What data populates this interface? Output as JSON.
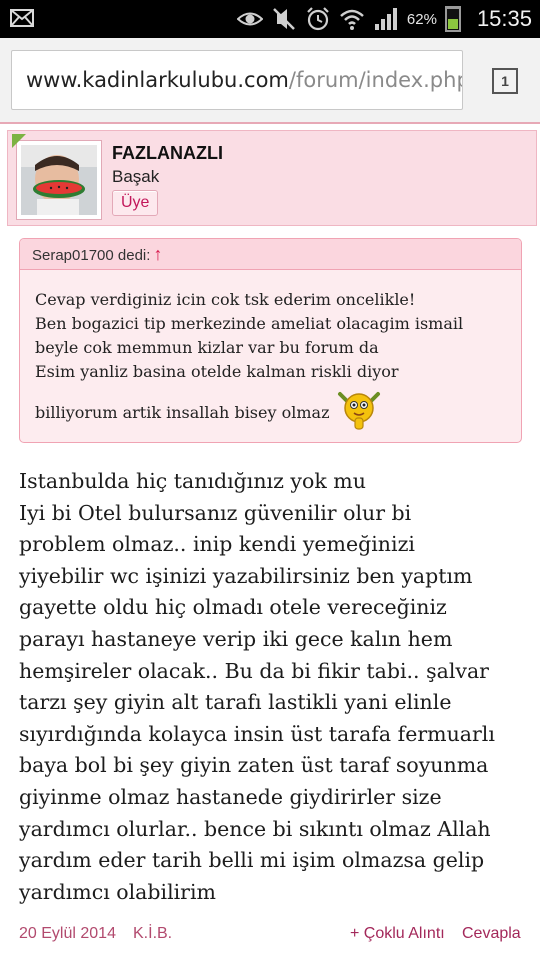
{
  "status_bar": {
    "battery_percent": "62%",
    "time": "15:35",
    "icons": [
      "mail-icon",
      "eye-icon",
      "vibrate-off-icon",
      "alarm-icon",
      "wifi-icon",
      "signal-icon",
      "battery-icon"
    ]
  },
  "browser": {
    "url_host": "www.kadinlarkulubu.com",
    "url_path": "/forum/index.php",
    "tab_count": "1"
  },
  "post": {
    "username": "FAZLANAZLI",
    "real_name": "Başak",
    "role": "Üye",
    "quote": {
      "author_label": "Serap01700 dedi:",
      "arrow": "↑",
      "lines": [
        "Cevap verdiginiz icin cok tsk ederim oncelikle!",
        "Ben bogazici tip merkezinde ameliat olacagim ismail",
        "beyle cok memmun kizlar var bu forum da",
        "Esim yanliz basina otelde kalman riskli diyor"
      ],
      "last_line": "billiyorum artik insallah bisey olmaz"
    },
    "body_lines": [
      "Istanbulda hiç tanıdığınız yok mu",
      "Iyi bi Otel bulursanız güvenilir olur bi",
      "problem olmaz.. inip kendi yemeğinizi",
      "yiyebilir wc işinizi yazabilirsiniz ben yaptım",
      "gayette oldu hiç olmadı otele vereceğiniz",
      "parayı hastaneye verip iki gece kalın hem",
      "hemşireler olacak.. Bu da bi fikir tabi.. şalvar",
      "tarzı şey giyin alt tarafı lastikli yani elinle",
      "sıyırdığında kolayca insin üst tarafa fermuarlı",
      "baya bol bi şey giyin zaten üst taraf soyunma",
      "giyinme olmaz hastanede giydirirler size",
      "yardımcı olurlar.. bence bi sıkıntı olmaz Allah",
      "yardım eder tarih belli mi işim olmazsa gelip",
      "yardımcı olabilirim"
    ],
    "footer": {
      "date": "20 Eylül 2014",
      "kib": "K.İ.B.",
      "multi_quote": "+ Çoklu Alıntı",
      "reply": "Cevapla"
    }
  }
}
